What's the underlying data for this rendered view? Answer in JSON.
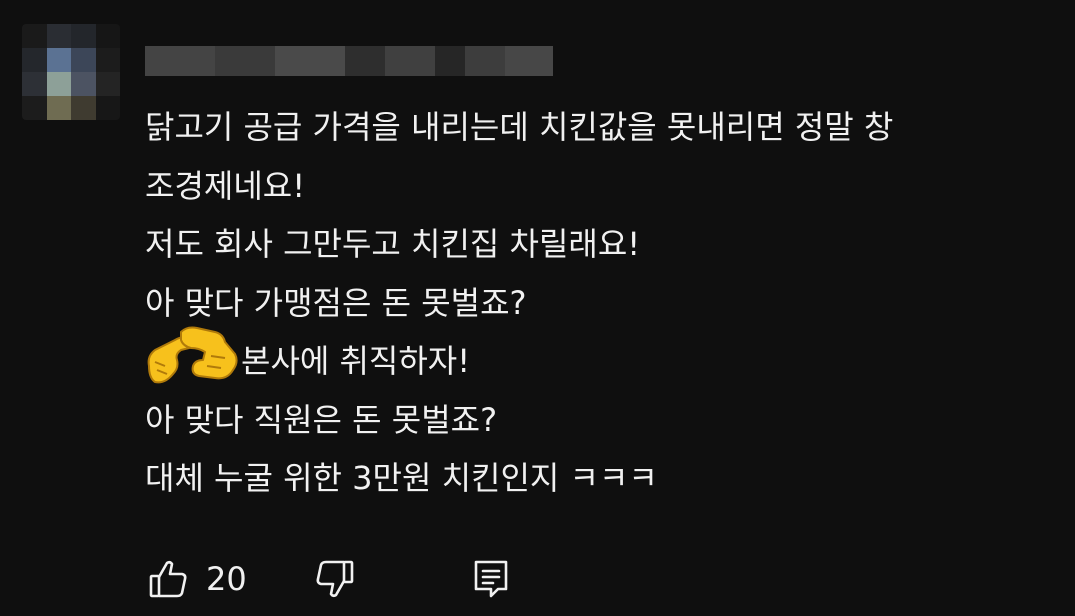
{
  "comment": {
    "lines": [
      "닭고기 공급 가격을 내리는데 치킨값을 못내리면 정말 창",
      "조경제네요!",
      "저도 회사 그만두고 치킨집 차릴래요!",
      "아 맞다 가맹점은 돈 못벌죠?",
      "본사에 취직하자!",
      "아 맞다 직원은 돈 못벌죠?",
      "대체 누굴 위한 3만원 치킨인지 ㅋㅋㅋ"
    ],
    "emoji_icon": "handshake-icon"
  },
  "actions": {
    "like_count": "20",
    "like_icon": "thumbs-up-icon",
    "dislike_icon": "thumbs-down-icon",
    "reply_icon": "comment-icon"
  },
  "colors": {
    "background": "#0f0f0f",
    "text": "#f1f1f1",
    "emoji": "#f7c11c"
  }
}
